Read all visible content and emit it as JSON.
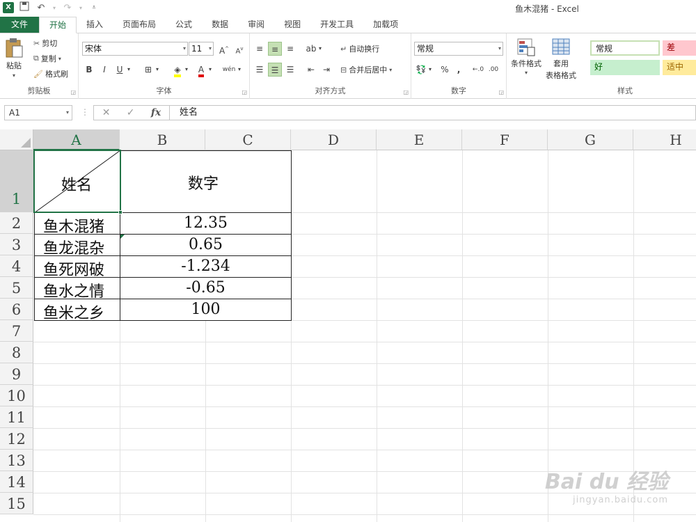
{
  "window": {
    "title": "鱼木混猪 - Excel",
    "logo": "X"
  },
  "qat": {
    "save_icon": "save-icon",
    "undo_icon": "undo-icon",
    "redo_icon": "redo-icon"
  },
  "tabs": [
    {
      "label": "文件"
    },
    {
      "label": "开始"
    },
    {
      "label": "插入"
    },
    {
      "label": "页面布局"
    },
    {
      "label": "公式"
    },
    {
      "label": "数据"
    },
    {
      "label": "审阅"
    },
    {
      "label": "视图"
    },
    {
      "label": "开发工具"
    },
    {
      "label": "加载项"
    }
  ],
  "ribbon": {
    "clipboard": {
      "paste": "粘贴",
      "cut": "剪切",
      "copy": "复制",
      "format_painter": "格式刷",
      "label": "剪贴板"
    },
    "font": {
      "name": "宋体",
      "size": "11",
      "grow": "A",
      "shrink": "A",
      "bold": "B",
      "italic": "I",
      "underline": "U",
      "label": "字体",
      "phonetic": "wén"
    },
    "alignment": {
      "wrap": "自动换行",
      "merge": "合并后居中",
      "label": "对齐方式"
    },
    "number": {
      "format": "常规",
      "percent": "%",
      "comma": ",",
      "label": "数字"
    },
    "styles": {
      "conditional": "条件格式",
      "table_l1": "套用",
      "table_l2": "表格格式",
      "normal": "常规",
      "bad": "差",
      "good": "好",
      "neutral": "适中",
      "label": "样式"
    }
  },
  "formula_bar": {
    "name_box": "A1",
    "fx": "fx",
    "formula": "姓名"
  },
  "grid": {
    "columns": [
      "A",
      "B",
      "C",
      "D",
      "E",
      "F",
      "G",
      "H"
    ],
    "rows": [
      "1",
      "2",
      "3",
      "4",
      "5",
      "6",
      "7",
      "8",
      "9",
      "10",
      "11",
      "12",
      "13",
      "14",
      "15"
    ],
    "header_name": "姓名",
    "header_number": "数字",
    "data": [
      {
        "name": "鱼木混猪",
        "value": "12.35"
      },
      {
        "name": "鱼龙混杂",
        "value": "0.65"
      },
      {
        "name": "鱼死网破",
        "value": "-1.234"
      },
      {
        "name": "鱼水之情",
        "value": "-0.65"
      },
      {
        "name": "鱼米之乡",
        "value": "100"
      }
    ]
  },
  "watermark": {
    "brand": "Bai du 经验",
    "url": "jingyan.baidu.com"
  },
  "colors": {
    "accent": "#217346",
    "selection_fill": "#d2d2d2",
    "good_fill": "#c6efce",
    "bad_fill": "#ffc7ce",
    "neutral_fill": "#ffeb9c"
  }
}
